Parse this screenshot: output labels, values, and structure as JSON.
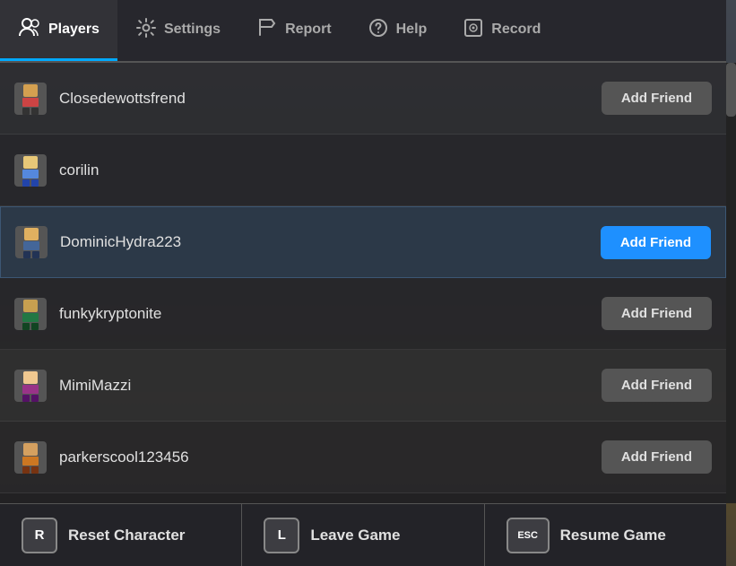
{
  "tabs": [
    {
      "id": "players",
      "label": "Players",
      "active": true
    },
    {
      "id": "settings",
      "label": "Settings",
      "active": false
    },
    {
      "id": "report",
      "label": "Report",
      "active": false
    },
    {
      "id": "help",
      "label": "Help",
      "active": false
    },
    {
      "id": "record",
      "label": "Record",
      "active": false
    }
  ],
  "players": [
    {
      "id": 1,
      "name": "Closedewottsfrend",
      "showAddFriend": true,
      "addFriendActive": false
    },
    {
      "id": 2,
      "name": "corilin",
      "showAddFriend": false,
      "addFriendActive": false
    },
    {
      "id": 3,
      "name": "DominicHydra223",
      "showAddFriend": true,
      "addFriendActive": true,
      "highlighted": true
    },
    {
      "id": 4,
      "name": "funkykryptonite",
      "showAddFriend": true,
      "addFriendActive": false
    },
    {
      "id": 5,
      "name": "MimiMazzi",
      "showAddFriend": true,
      "addFriendActive": false
    },
    {
      "id": 6,
      "name": "parkerscool123456",
      "showAddFriend": true,
      "addFriendActive": false
    }
  ],
  "actions": [
    {
      "id": "reset",
      "key": "R",
      "label": "Reset Character"
    },
    {
      "id": "leave",
      "key": "L",
      "label": "Leave Game"
    },
    {
      "id": "resume",
      "key": "ESC",
      "label": "Resume Game"
    }
  ],
  "addFriendLabel": "Add Friend",
  "colors": {
    "activeTab": "#00aaff",
    "activeFriendBtn": "#1e90ff"
  }
}
